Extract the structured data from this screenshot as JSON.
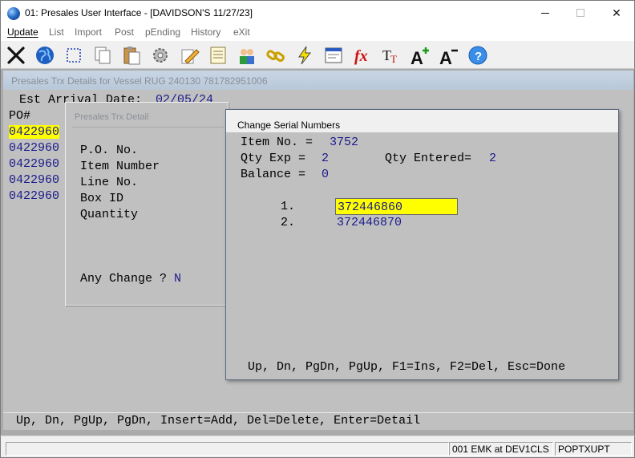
{
  "window": {
    "title": "01: Presales User Interface - [DAVIDSON'S 11/27/23]",
    "icon": "globe-icon"
  },
  "menu": [
    {
      "label": "Update",
      "accel": "U",
      "active": true
    },
    {
      "label": "List",
      "accel": "L",
      "active": false
    },
    {
      "label": "Import",
      "accel": "I",
      "active": false
    },
    {
      "label": "Post",
      "accel": "P",
      "active": false
    },
    {
      "label": "pEnding",
      "accel": "E",
      "active": false
    },
    {
      "label": "History",
      "accel": "H",
      "active": false
    },
    {
      "label": "eXit",
      "accel": "X",
      "active": false
    }
  ],
  "toolbar": [
    "close-x-icon",
    "globe-icon",
    "select-box-icon",
    "copy-pages-icon",
    "paste-clipboard-icon",
    "settings-gear-icon",
    "edit-pencil-icon",
    "notepad-icon",
    "users-icon",
    "chain-link-icon",
    "lightning-icon",
    "form-window-icon",
    "function-fx-icon",
    "font-tt-icon",
    "font-increase-icon",
    "font-decrease-icon",
    "help-icon"
  ],
  "vessel": {
    "caption": "Presales Trx Details for Vessel  RUG 240130 781782951006",
    "arrival_label": "Est Arrival Date:",
    "arrival_value": "02/05/24",
    "po_header": "PO#",
    "po_rows": [
      "0422960",
      "0422960",
      "0422960",
      "0422960",
      "0422960"
    ],
    "status": "Up, Dn, PgUp, PgDn, Insert=Add, Del=Delete, Enter=Detail"
  },
  "trx_detail": {
    "caption": "Presales Trx Detail",
    "fields": [
      "P.O. No.",
      "Item Number",
      "Line No.",
      "Box ID",
      "Quantity"
    ],
    "any_change_label": "Any Change ?",
    "any_change_value": "N"
  },
  "serial": {
    "caption": "Change Serial Numbers",
    "item_label": "Item No. =",
    "item_value": "3752",
    "qty_exp_label": "Qty Exp =",
    "qty_exp_value": "2",
    "qty_entered_label": "Qty Entered=",
    "qty_entered_value": "2",
    "balance_label": "Balance =",
    "balance_value": "0",
    "lines": [
      {
        "num": "1.",
        "value": "372446860"
      },
      {
        "num": "2.",
        "value": "372446870"
      }
    ],
    "help": "Up, Dn, PgDn, PgUp, F1=Ins, F2=Del, Esc=Done"
  },
  "statusbar": {
    "main": "",
    "user": "001 EMK at DEV1CLS",
    "program": "POPTXUPT"
  },
  "colors": {
    "highlight": "#ffff00",
    "value_text": "#1a1a8c",
    "panel": "#c0c0c0"
  }
}
